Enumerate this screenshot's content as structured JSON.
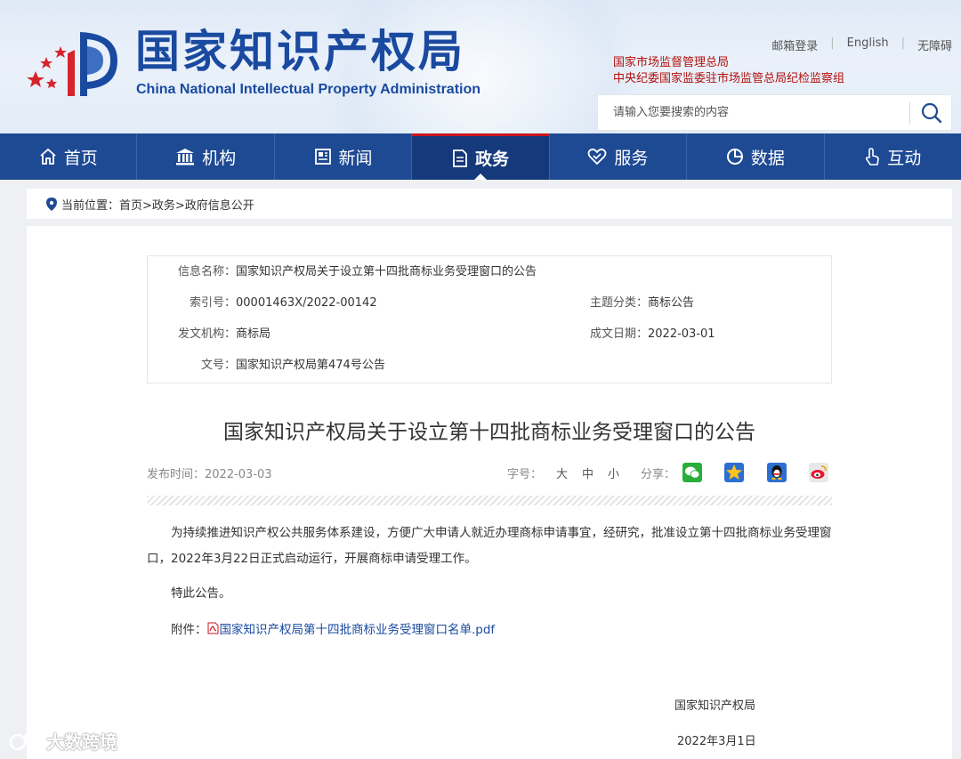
{
  "site": {
    "name_cn": "国家知识产权局",
    "name_en": "China National Intellectual Property Administration"
  },
  "top_links": [
    "邮箱登录",
    "English",
    "无障碍"
  ],
  "supervise": [
    "国家市场监督管理总局",
    "中央纪委国家监委驻市场监管总局纪检监察组"
  ],
  "search": {
    "placeholder": "请输入您要搜索的内容"
  },
  "nav": [
    {
      "label": "首页",
      "icon": "home-icon"
    },
    {
      "label": "机构",
      "icon": "institution-icon"
    },
    {
      "label": "新闻",
      "icon": "news-icon"
    },
    {
      "label": "政务",
      "icon": "document-icon",
      "active": true
    },
    {
      "label": "服务",
      "icon": "service-icon"
    },
    {
      "label": "数据",
      "icon": "data-icon"
    },
    {
      "label": "互动",
      "icon": "interact-icon"
    }
  ],
  "breadcrumb": "当前位置：首页>政务>政府信息公开",
  "info": {
    "name_label": "信息名称：",
    "name_value": "国家知识产权局关于设立第十四批商标业务受理窗口的公告",
    "index_label": "索引号：",
    "index_value": "00001463X/2022-00142",
    "topic_label": "主题分类：",
    "topic_value": "商标公告",
    "issuer_label": "发文机构：",
    "issuer_value": "商标局",
    "date_label": "成文日期：",
    "date_value": "2022-03-01",
    "docno_label": "文号：",
    "docno_value": "国家知识产权局第474号公告"
  },
  "article": {
    "title": "国家知识产权局关于设立第十四批商标业务受理窗口的公告",
    "publish": "发布时间：2022-03-03",
    "font_label": "字号：",
    "font_sizes": [
      "大",
      "中",
      "小"
    ],
    "share_label": "分享：",
    "share_icons": [
      "wechat-icon",
      "qzone-icon",
      "qq-icon",
      "weibo-icon"
    ],
    "paragraph1": "为持续推进知识产权公共服务体系建设，方便广大申请人就近办理商标申请事宜，经研究，批准设立第十四批商标业务受理窗口，2022年3月22日正式启动运行，开展商标申请受理工作。",
    "paragraph2": "特此公告。",
    "attach_label": "附件：",
    "attach_link": "国家知识产权局第十四批商标业务受理窗口名单.pdf",
    "sign_org": "国家知识产权局",
    "sign_date": "2022年3月1日"
  },
  "watermark": "大数跨境",
  "colors": {
    "brand": "#1e4a94",
    "accent_red": "#c9151e",
    "link": "#1a4aa0"
  }
}
